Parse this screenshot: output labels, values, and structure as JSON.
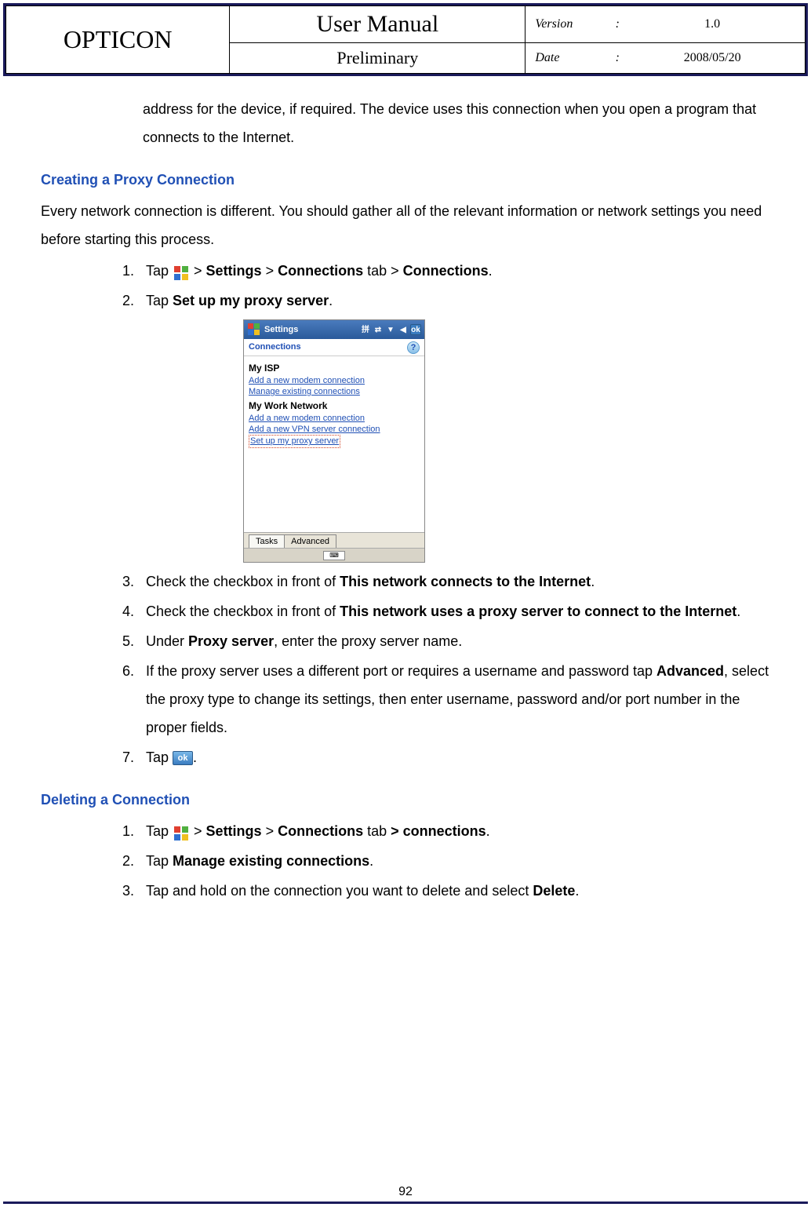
{
  "header": {
    "brand": "OPTICON",
    "title": "User Manual",
    "subtitle": "Preliminary",
    "version_label": "Version",
    "version_value": "1.0",
    "date_label": "Date",
    "date_value": "2008/05/20"
  },
  "intro": "address for the device, if required. The device uses this connection when you open a program that connects to the Internet.",
  "section1": {
    "heading": "Creating a Proxy Connection",
    "intro": "Every network connection is different. You should gather all of the relevant information or network settings you need before starting this process.",
    "step1_a": "Tap ",
    "step1_b": " > ",
    "step1_c": "Settings",
    "step1_d": " > ",
    "step1_e": "Connections",
    "step1_f": " tab > ",
    "step1_g": "Connections",
    "step1_h": ".",
    "step2_a": "Tap ",
    "step2_b": "Set up my proxy server",
    "step2_c": ".",
    "step3_a": "Check the checkbox in front of ",
    "step3_b": "This network connects to the Internet",
    "step3_c": ".",
    "step4_a": "Check the checkbox in front of ",
    "step4_b": "This network uses a proxy server to connect to the Internet",
    "step4_c": ".",
    "step5_a": "Under ",
    "step5_b": "Proxy server",
    "step5_c": ", enter the proxy server name.",
    "step6_a": "If the proxy server uses a different port or requires a username and password tap ",
    "step6_b": "Advanced",
    "step6_c": ", select the proxy type to change its settings, then enter username, password and/or port number in the proper fields.",
    "step7_a": "Tap ",
    "step7_c": "."
  },
  "section2": {
    "heading": "Deleting a Connection",
    "step1_a": "Tap ",
    "step1_b": " > ",
    "step1_c": "Settings",
    "step1_d": " > ",
    "step1_e": "Connections",
    "step1_f": " tab ",
    "step1_g": "> connections",
    "step1_h": ".",
    "step2_a": "Tap ",
    "step2_b": "Manage existing connections",
    "step2_c": ".",
    "step3_a": "Tap and hold on the connection you want to delete and select ",
    "step3_b": "Delete",
    "step3_c": "."
  },
  "screenshot": {
    "title": "Settings",
    "ok": "ok",
    "subtitle": "Connections",
    "help": "?",
    "group1": "My ISP",
    "link1": "Add a new modem connection",
    "link2": "Manage existing connections",
    "group2": "My Work Network",
    "link3": "Add a new modem connection",
    "link4": "Add a new VPN server connection",
    "link5": "Set up my proxy server",
    "tab1": "Tasks",
    "tab2": "Advanced"
  },
  "ok_label": "ok",
  "page_number": "92"
}
